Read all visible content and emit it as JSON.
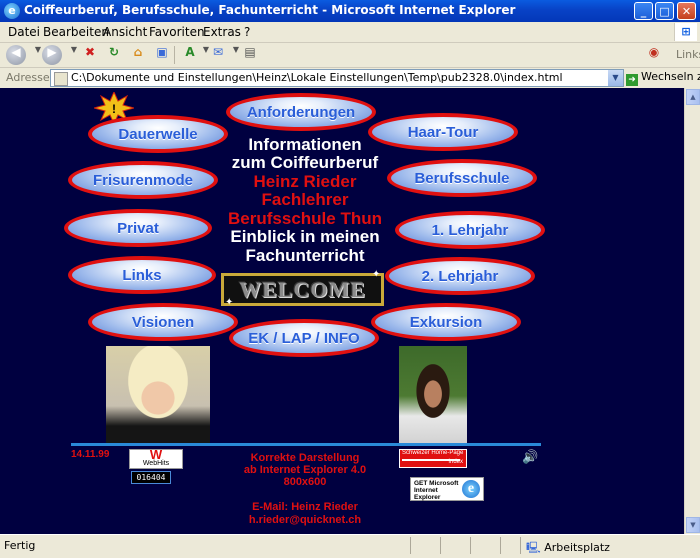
{
  "window": {
    "title": "Coiffeurberuf, Berufsschule, Fachunterricht - Microsoft Internet Explorer",
    "minimize": "_",
    "maximize": "□",
    "close": "✕"
  },
  "menu": {
    "items": [
      "Datei",
      "Bearbeiten",
      "Ansicht",
      "Favoriten",
      "Extras",
      "?"
    ]
  },
  "toolbar": {
    "links_label": "Links"
  },
  "address": {
    "label": "Adresse",
    "url": "C:\\Dokumente und Einstellungen\\Heinz\\Lokale Einstellungen\\Temp\\pub2328.0\\index.html",
    "go_label": "Wechseln zu"
  },
  "page": {
    "nav": {
      "anforderungen": "Anforderungen",
      "dauerwelle": "Dauerwelle",
      "haartour": "Haar-Tour",
      "frisurenmode": "Frisurenmode",
      "berufsschule": "Berufsschule",
      "privat": "Privat",
      "lehrjahr1": "1. Lehrjahr",
      "links": "Links",
      "lehrjahr2": "2. Lehrjahr",
      "visionen": "Visionen",
      "exkursion": "Exkursion",
      "ek_lap_info": "EK / LAP / INFO"
    },
    "headline": {
      "line1": "Informationen",
      "line2": "zum Coiffeurberuf",
      "line3": "Heinz Rieder",
      "line4": "Fachlehrer",
      "line5": "Berufsschule Thun",
      "line6": "Einblick in meinen",
      "line7": "Fachunterricht"
    },
    "welcome": "WELCOME",
    "footer": {
      "date": "14.11.99",
      "webhits_logo": "W",
      "webhits_name": "WebHits",
      "counter": "016404",
      "display_line1": "Korrekte Darstellung",
      "display_line2": "ab Internet Explorer 4.0",
      "display_line3": "800x600",
      "email_label": "E-Mail: Heinz Rieder",
      "email": "h.rieder@quicknet.ch",
      "homepage_text": "Schweizer Home-Page",
      "homepage_index": "Index",
      "ie_badge": "GET Microsoft Internet Explorer"
    }
  },
  "status": {
    "left": "Fertig",
    "zone": "Arbeitsplatz"
  },
  "colors": {
    "page_bg": "#000040",
    "oval_border": "#e01010",
    "oval_text": "#2a5ed8",
    "headline_white": "#ffffff",
    "headline_red": "#e01010",
    "rule": "#2a8ad8"
  }
}
